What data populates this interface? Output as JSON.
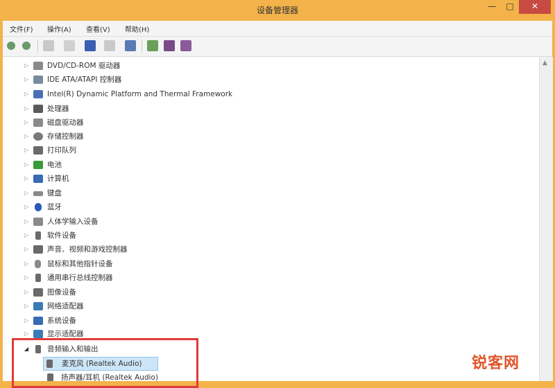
{
  "window": {
    "title": "设备管理器",
    "min": "—",
    "max": "□",
    "close": "✕"
  },
  "menubar": {
    "items": [
      "文件(F)",
      "操作(A)",
      "查看(V)",
      "帮助(H)"
    ]
  },
  "tree": [
    {
      "label": "DVD/CD-ROM 驱动器",
      "icon": "dvd-drive-icon",
      "color": "#8a8a8a",
      "expanded": false
    },
    {
      "label": "IDE ATA/ATAPI 控制器",
      "icon": "ide-controller-icon",
      "color": "#7a8a9a",
      "expanded": false
    },
    {
      "label": "Intel(R) Dynamic Platform and Thermal Framework",
      "icon": "thermal-framework-icon",
      "color": "#4a6fb5",
      "expanded": false
    },
    {
      "label": "处理器",
      "icon": "processor-icon",
      "color": "#5a5a5a",
      "expanded": false
    },
    {
      "label": "磁盘驱动器",
      "icon": "disk-drive-icon",
      "color": "#8a8a8a",
      "expanded": false
    },
    {
      "label": "存储控制器",
      "icon": "storage-controller-icon",
      "color": "#7a7a7a",
      "expanded": false
    },
    {
      "label": "打印队列",
      "icon": "printer-icon",
      "color": "#6a6a6a",
      "expanded": false
    },
    {
      "label": "电池",
      "icon": "battery-icon",
      "color": "#3a9a3a",
      "expanded": false
    },
    {
      "label": "计算机",
      "icon": "computer-icon",
      "color": "#3a6ab5",
      "expanded": false
    },
    {
      "label": "键盘",
      "icon": "keyboard-icon",
      "color": "#8a8a8a",
      "expanded": false
    },
    {
      "label": "蓝牙",
      "icon": "bluetooth-icon",
      "color": "#2a5ab5",
      "expanded": false
    },
    {
      "label": "人体学输入设备",
      "icon": "hid-icon",
      "color": "#8a8a8a",
      "expanded": false
    },
    {
      "label": "软件设备",
      "icon": "software-device-icon",
      "color": "#6a6a6a",
      "expanded": false
    },
    {
      "label": "声音、视频和游戏控制器",
      "icon": "sound-icon",
      "color": "#6a6a6a",
      "expanded": false
    },
    {
      "label": "鼠标和其他指针设备",
      "icon": "mouse-icon",
      "color": "#8a8a8a",
      "expanded": false
    },
    {
      "label": "通用串行总线控制器",
      "icon": "usb-controller-icon",
      "color": "#6a6a6a",
      "expanded": false
    },
    {
      "label": "图像设备",
      "icon": "imaging-device-icon",
      "color": "#6a6a6a",
      "expanded": false
    },
    {
      "label": "网络适配器",
      "icon": "network-adapter-icon",
      "color": "#3a7ab5",
      "expanded": false
    },
    {
      "label": "系统设备",
      "icon": "system-device-icon",
      "color": "#3a6ab5",
      "expanded": false
    },
    {
      "label": "显示适配器",
      "icon": "display-adapter-icon",
      "color": "#3a7ab5",
      "expanded": false
    },
    {
      "label": "音频输入和输出",
      "icon": "audio-io-icon",
      "color": "#6a6a6a",
      "expanded": true
    }
  ],
  "children": [
    {
      "label": "麦克风 (Realtek Audio)",
      "icon": "microphone-icon",
      "color": "#6a6a6a",
      "selected": true
    },
    {
      "label": "扬声器/耳机 (Realtek Audio)",
      "icon": "speaker-icon",
      "color": "#6a6a6a",
      "selected": false
    }
  ],
  "watermark": "锐客网",
  "colors": {
    "titlebar": "#f3b24a",
    "close": "#c74b43",
    "highlight_box": "#e03a3a",
    "selection": "#cde6f7"
  }
}
